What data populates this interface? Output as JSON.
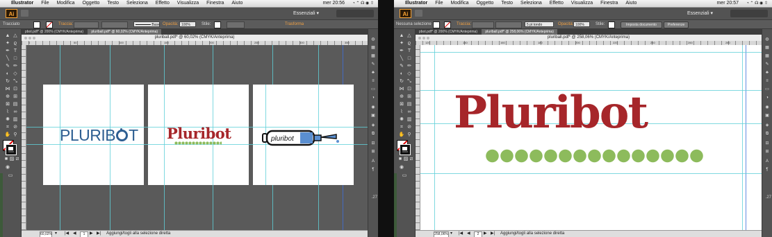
{
  "menu": {
    "app": "Illustrator",
    "items": [
      "File",
      "Modifica",
      "Oggetto",
      "Testo",
      "Seleziona",
      "Effetto",
      "Visualizza",
      "Finestra",
      "Aiuto"
    ],
    "status_icons": "◔ ⌃ ☊ ◉ ⇧"
  },
  "app": {
    "logo": "Ai",
    "bridge_label": "■▾",
    "workspace": "Essenziali ▾"
  },
  "screens": [
    {
      "clock": "mer 20:56",
      "control": {
        "selection": "Tracciato",
        "stroke_label": "Traccia:",
        "brush_label": "Base",
        "opacity_label": "Opacità:",
        "opacity_value": "100%",
        "style_label": "Stile:",
        "transform_label": "Trasforma"
      },
      "tabs": [
        "pbot.pdf* @ 200% (CMYK/Anteprima)",
        "pluriball.pdf* @ 60,02% (CMYK/Anteprima)"
      ],
      "doc_title": "pluriball.pdf* @ 60,02% (CMYK/Anteprima)",
      "ruler_marks": [
        "0",
        "50",
        "100",
        "150",
        "200",
        "250",
        "300",
        "350"
      ],
      "artboards": [
        {
          "logo_text": "PLURIB",
          "logo_text_end": "T"
        },
        {
          "logo_text": "Pluribot"
        },
        {
          "logo_text": "pluribot"
        }
      ],
      "status": {
        "zoom": "60,02%",
        "page": "1",
        "message": "Aggiungi/togli alla selezione diretta"
      },
      "edge_number": ".27"
    },
    {
      "clock": "mer 20:57",
      "control": {
        "selection": "Nessuna selezione",
        "stroke_label": "Traccia:",
        "brush_label": "5 pt tondo",
        "opacity_label": "Opacità:",
        "opacity_value": "100%",
        "style_label": "Stile:",
        "doc_setup": "Imposta documento",
        "preferences": "Preferenze"
      },
      "tabs": [
        "pbot.pdf* @ 200% (CMYK/Anteprima)",
        "pluriball.pdf* @ 258,06% (CMYK/Anteprima)"
      ],
      "doc_title": "pluriball.pdf* @ 258,06% (CMYK/Anteprima)",
      "ruler_marks": [
        "120",
        "140",
        "160",
        "180",
        "200",
        "220",
        "240",
        "260",
        "280"
      ],
      "artboards": [
        {
          "logo_text": "Pluribot"
        }
      ],
      "status": {
        "zoom": "258,06%",
        "page": "2",
        "message": "Aggiungi/togli alla selezione diretta"
      },
      "edge_number": ".27"
    }
  ],
  "colors": {
    "pluribot_red": "#a6262a",
    "bubble_green": "#8dbb5c",
    "pluribot_blue": "#2e5f92",
    "syringe_blue": "#5a8fd0",
    "guide": "#5fd0d8"
  }
}
